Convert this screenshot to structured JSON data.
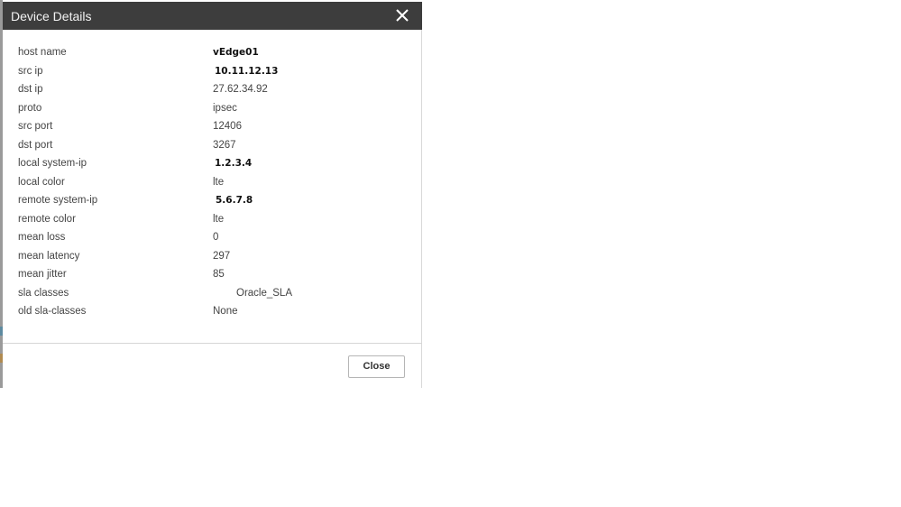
{
  "dialog": {
    "title": "Device Details",
    "close_icon": "close-icon",
    "close_button_label": "Close"
  },
  "details": [
    {
      "label": "host name",
      "value": "vEdge01"
    },
    {
      "label": "src ip",
      "value": "10.11.12.13"
    },
    {
      "label": "dst ip",
      "value": "27.62.34.92"
    },
    {
      "label": "proto",
      "value": "ipsec"
    },
    {
      "label": "src port",
      "value": "12406"
    },
    {
      "label": "dst port",
      "value": "3267"
    },
    {
      "label": "local system-ip",
      "value": "1.2.3.4"
    },
    {
      "label": "local color",
      "value": "lte"
    },
    {
      "label": "remote system-ip",
      "value": "5.6.7.8"
    },
    {
      "label": "remote color",
      "value": "lte"
    },
    {
      "label": "mean loss",
      "value": "0"
    },
    {
      "label": "mean latency",
      "value": "297"
    },
    {
      "label": "mean jitter",
      "value": "85"
    },
    {
      "label": "sla classes",
      "value": "Oracle_SLA"
    },
    {
      "label": "old sla-classes",
      "value": "None"
    }
  ],
  "colors": {
    "header_bg": "#3d3d3d",
    "header_text": "#f2f2f2",
    "label_text": "#444444"
  }
}
